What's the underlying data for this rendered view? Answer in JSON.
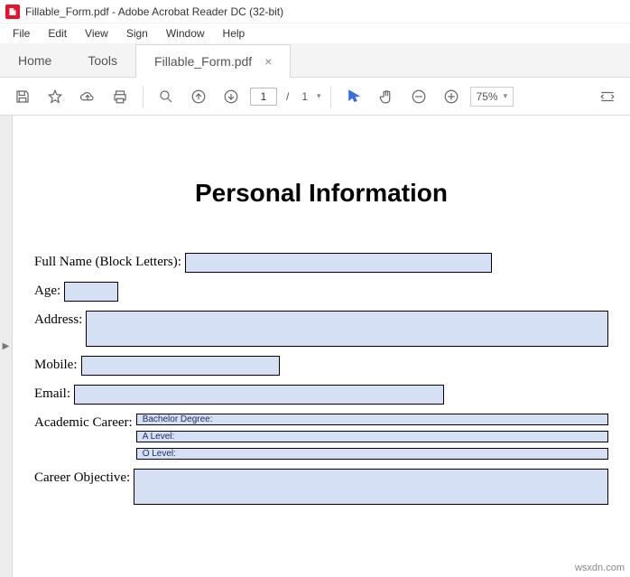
{
  "window": {
    "title": "Fillable_Form.pdf - Adobe Acrobat Reader DC (32-bit)"
  },
  "menu": {
    "file": "File",
    "edit": "Edit",
    "view": "View",
    "sign": "Sign",
    "window": "Window",
    "help": "Help"
  },
  "tabs": {
    "home": "Home",
    "tools": "Tools",
    "doc": "Fillable_Form.pdf"
  },
  "toolbar": {
    "page_current": "1",
    "page_sep": "/",
    "page_total": "1",
    "zoom_value": "75%"
  },
  "form": {
    "heading": "Personal Information",
    "full_name_label": "Full Name (Block Letters):",
    "age_label": "Age:",
    "address_label": "Address:",
    "mobile_label": "Mobile:",
    "email_label": "Email:",
    "academic_label": "Academic Career:",
    "academic_1": "Bachelor Degree:",
    "academic_2": "A Level:",
    "academic_3": "O Level:",
    "objective_label": "Career Objective:"
  },
  "watermark": "wsxdn.com"
}
